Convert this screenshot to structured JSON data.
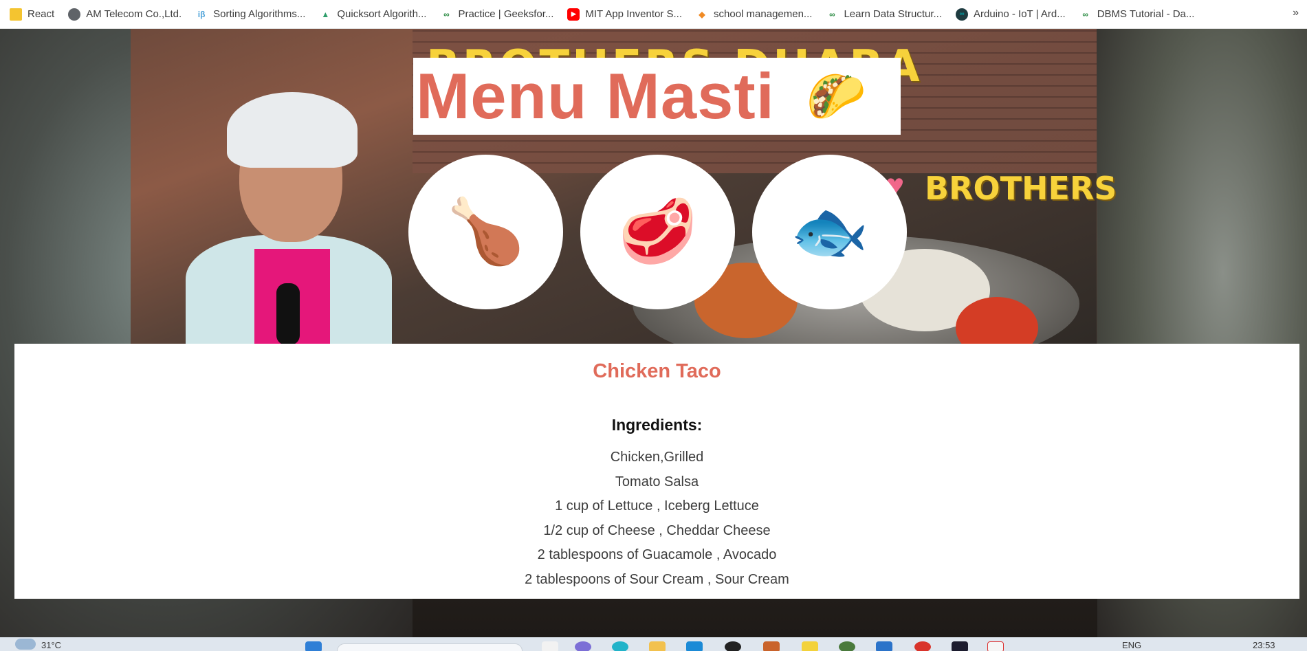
{
  "bookmarks": [
    {
      "label": "React",
      "icon": "folder-icon",
      "color": "#f4c430"
    },
    {
      "label": "AM Telecom Co.,Ltd.",
      "icon": "globe-icon",
      "color": "#5f6368"
    },
    {
      "label": "Sorting Algorithms...",
      "icon": "ib-logo-icon",
      "color": "#4fa3d9"
    },
    {
      "label": "Quicksort Algorith...",
      "icon": "chart-icon",
      "color": "#2e9e6b"
    },
    {
      "label": "Practice | Geeksfor...",
      "icon": "gfg-icon",
      "color": "#2f8d46"
    },
    {
      "label": "MIT App Inventor S...",
      "icon": "youtube-icon",
      "color": "#ff0000"
    },
    {
      "label": "school managemen...",
      "icon": "diamond-icon",
      "color": "#f08a24"
    },
    {
      "label": "Learn Data Structur...",
      "icon": "gfg-icon",
      "color": "#2f8d46"
    },
    {
      "label": "Arduino - IoT | Ard...",
      "icon": "arduino-icon",
      "color": "#00979d"
    },
    {
      "label": "DBMS Tutorial - Da...",
      "icon": "gfg-icon",
      "color": "#2f8d46"
    }
  ],
  "bookmarks_more": "»",
  "banner": {
    "title": "Menu Masti",
    "emoji": "🌮"
  },
  "categories": [
    {
      "name": "chicken",
      "emoji": "🍗"
    },
    {
      "name": "meat",
      "emoji": "🥩"
    },
    {
      "name": "fish",
      "emoji": "🐟"
    }
  ],
  "recipe": {
    "title": "Chicken Taco",
    "ingredients_heading": "Ingredients:",
    "ingredients": [
      "Chicken,Grilled",
      "Tomato Salsa",
      "1 cup of Lettuce , Iceberg Lettuce",
      "1/2 cup of Cheese , Cheddar Cheese",
      "2 tablespoons of Guacamole , Avocado",
      "2 tablespoons of Sour Cream , Sour Cream"
    ]
  },
  "background_signs": {
    "top": "BROTHERS DHABA",
    "right": "BROTHERS"
  },
  "taskbar": {
    "weather": "31°C",
    "language": "ENG",
    "time": "23:53"
  },
  "colors": {
    "accent": "#e06b5a",
    "panel": "#ffffff"
  }
}
